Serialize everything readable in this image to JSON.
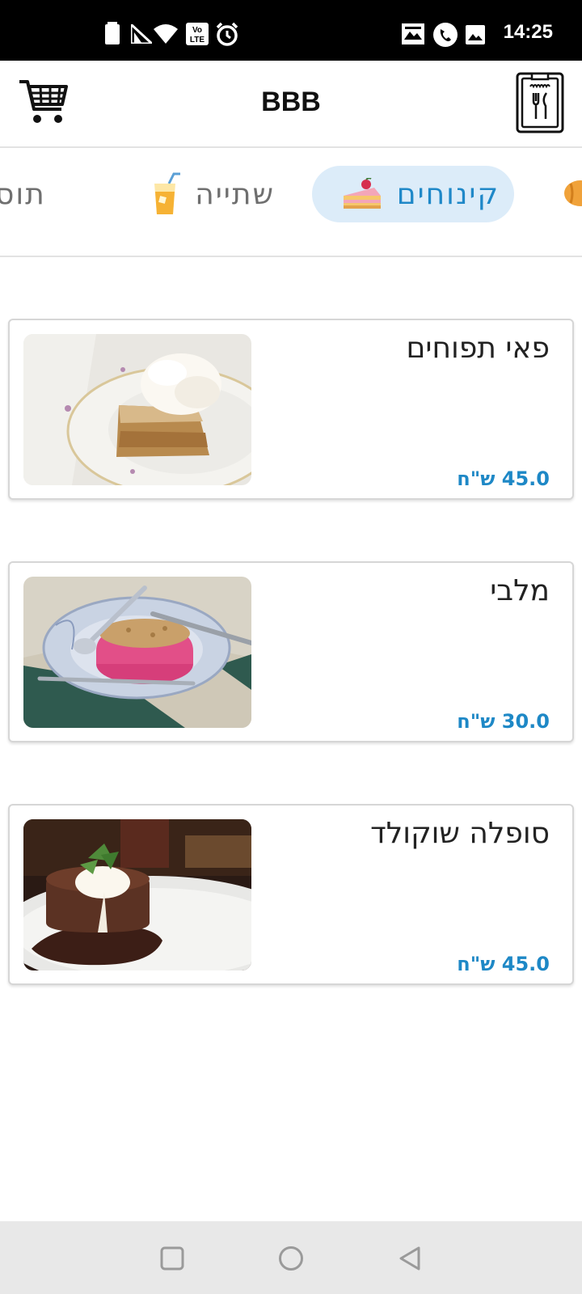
{
  "status_bar": {
    "time": "14:25",
    "left_icons": [
      "battery-icon",
      "signal-icon",
      "wifi-icon",
      "volte-icon",
      "alarm-icon"
    ],
    "right_icons": [
      "image-icon",
      "phone-icon",
      "gallery-icon"
    ]
  },
  "app_bar": {
    "title": "BBB",
    "left_icon": "cart-icon",
    "right_icon": "menu-board-icon"
  },
  "categories": {
    "items": [
      {
        "label": "קינוחים",
        "icon": "cake-icon",
        "active": true
      },
      {
        "label": "שתייה",
        "icon": "drink-icon",
        "active": false
      },
      {
        "label": "תוס",
        "icon": "",
        "active": false
      }
    ],
    "partial_left_icon": "croissant-icon"
  },
  "products": [
    {
      "name": "פאי תפוחים",
      "price": "45.0 ש\"ח",
      "image": "apple-pie-photo"
    },
    {
      "name": "מלבי",
      "price": "30.0 ש\"ח",
      "image": "malabi-photo"
    },
    {
      "name": "סופלה שוקולד",
      "price": "45.0 ש\"ח",
      "image": "chocolate-souffle-photo"
    }
  ],
  "nav_bar": {
    "icons": [
      "recents-icon",
      "home-icon",
      "back-icon"
    ]
  },
  "colors": {
    "accent": "#1f88c8",
    "active_tab_bg": "#dcecf9",
    "price": "#1e88c6",
    "status_bar": "#000000",
    "nav_bar": "#e8e8e8"
  }
}
